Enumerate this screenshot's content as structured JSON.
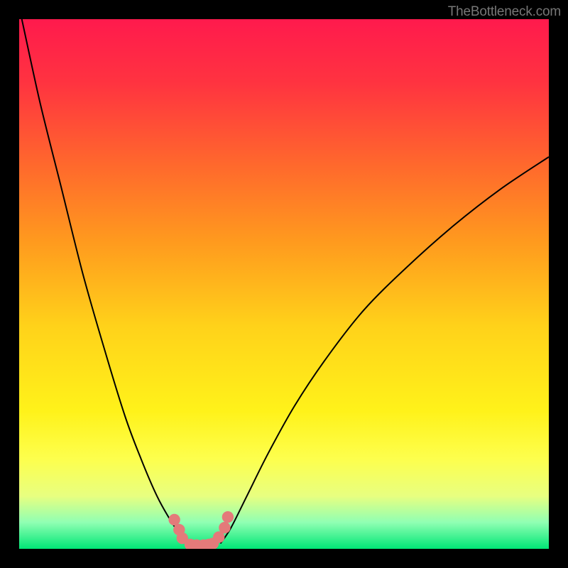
{
  "watermark": "TheBottleneck.com",
  "chart_data": {
    "type": "line",
    "title": "",
    "xlabel": "",
    "ylabel": "",
    "xlim": [
      0,
      100
    ],
    "ylim": [
      0,
      100
    ],
    "series": [
      {
        "name": "curve-left",
        "x": [
          0.5,
          4,
          8,
          12,
          16,
          20,
          23,
          26,
          28.5,
          30.5,
          32
        ],
        "y": [
          100,
          84,
          68,
          52,
          38,
          25,
          17,
          10,
          5.5,
          2.5,
          0.6
        ]
      },
      {
        "name": "curve-right",
        "x": [
          38,
          40,
          43,
          47,
          52,
          58,
          65,
          73,
          82,
          91,
          100
        ],
        "y": [
          1,
          4,
          10,
          18,
          27,
          36,
          45,
          53,
          61,
          68,
          74
        ]
      },
      {
        "name": "dots",
        "x": [
          29.3,
          30.2,
          30.8,
          32.3,
          33.5,
          34.8,
          35.8,
          36.6,
          37.7,
          38.8,
          39.4
        ],
        "y": [
          5.5,
          3.6,
          2.0,
          0.8,
          0.7,
          0.7,
          0.8,
          1.0,
          2.2,
          4.0,
          6.0
        ]
      }
    ],
    "dot_radius": 1.1
  }
}
